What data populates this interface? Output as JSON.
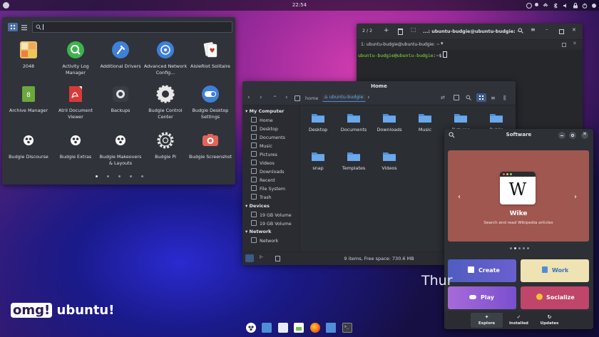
{
  "panel": {
    "clock": "22:54"
  },
  "launcher": {
    "search_placeholder": "",
    "apps": [
      {
        "label": "2048",
        "icon": "2048-icon"
      },
      {
        "label": "Activity Log Manager",
        "icon": "activity-log-icon"
      },
      {
        "label": "Additional Drivers",
        "icon": "drivers-icon"
      },
      {
        "label": "Advanced Network Config...",
        "icon": "network-config-icon"
      },
      {
        "label": "AisleRiot Solitaire",
        "icon": "solitaire-icon"
      },
      {
        "label": "Archive Manager",
        "icon": "archive-icon"
      },
      {
        "label": "Atril Document Viewer",
        "icon": "pdf-icon"
      },
      {
        "label": "Backups",
        "icon": "backups-icon"
      },
      {
        "label": "Budgie Control Center",
        "icon": "gear-icon"
      },
      {
        "label": "Budgie Desktop Settings",
        "icon": "toggle-icon"
      },
      {
        "label": "Budgie Discourse",
        "icon": "budgie-icon"
      },
      {
        "label": "Budgie Extras",
        "icon": "budgie-icon"
      },
      {
        "label": "Budgie Makeovers & Layouts",
        "icon": "budgie-icon"
      },
      {
        "label": "Budgie Pi",
        "icon": "gear-outline-icon"
      },
      {
        "label": "Budgie Screenshot",
        "icon": "camera-icon"
      }
    ]
  },
  "terminal": {
    "counter": "2 / 2",
    "title": "...: ubuntu-budgie@ubuntu-budgie: ~",
    "tab": "1: ubuntu-budgie@ubuntu-budgie: ~",
    "prompt_user": "ubuntu-budgie@ubuntu-budgie",
    "prompt_path": ":~$"
  },
  "files": {
    "title": "Home",
    "crumb_parent": "home",
    "crumb_current": "ubuntu-budgie",
    "sections": [
      {
        "title": "My Computer",
        "items": [
          "Home",
          "Desktop",
          "Documents",
          "Music",
          "Pictures",
          "Videos",
          "Downloads",
          "Recent",
          "File System",
          "Trash"
        ]
      },
      {
        "title": "Devices",
        "items": [
          "19 GB Volume",
          "19 GB Volume"
        ]
      },
      {
        "title": "Network",
        "items": [
          "Network"
        ]
      }
    ],
    "folders": [
      "Desktop",
      "Documents",
      "Downloads",
      "Music",
      "Pictures",
      "Public",
      "snap",
      "Templates",
      "Videos"
    ],
    "status": "9 items, Free space: 730.6 MB"
  },
  "software": {
    "title": "Software",
    "featured_name": "Wike",
    "featured_desc": "Search and read Wikipedia articles",
    "categories": [
      {
        "label": "Create",
        "color": "#5b5fc7"
      },
      {
        "label": "Work",
        "color": "#f0e6b8"
      },
      {
        "label": "Play",
        "color": "#8d5bd6"
      },
      {
        "label": "Socialize",
        "color": "#c0456a"
      }
    ],
    "tabs": [
      "Explore",
      "Installed",
      "Updates"
    ]
  },
  "desktop": {
    "clock_partial": "Thur",
    "logo_a": "omg!",
    "logo_b": "ubuntu!"
  }
}
